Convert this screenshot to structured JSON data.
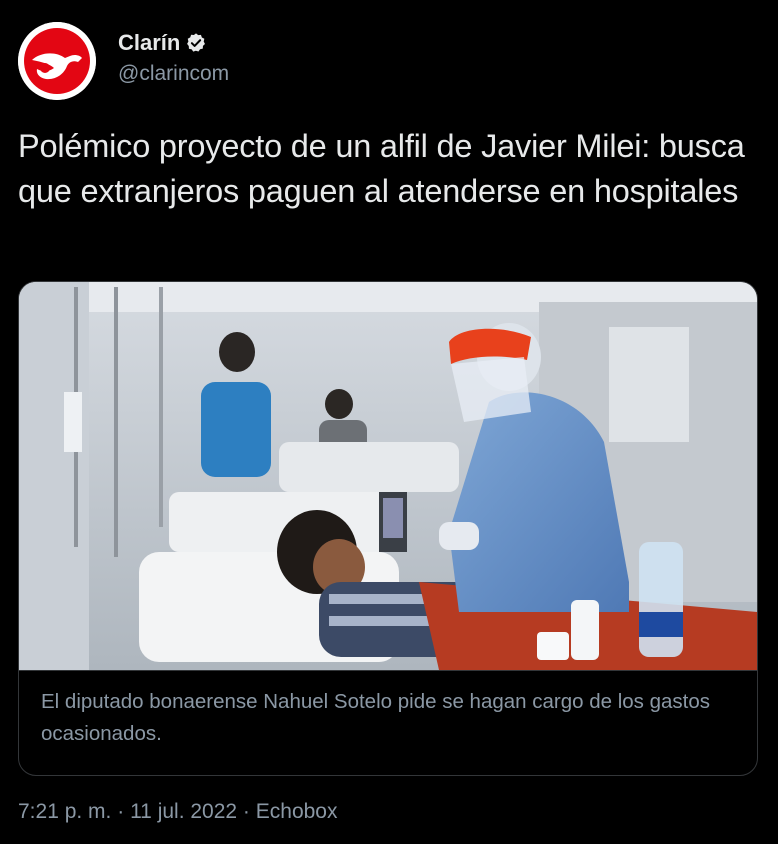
{
  "account": {
    "display_name": "Clarín",
    "handle": "@clarincom",
    "avatar_icon": "clarin-logo-icon",
    "verified_icon": "verified-badge-icon",
    "brand_color": "#e30613"
  },
  "tweet": {
    "text": "Polémico proyecto de un alfil de Javier Milei: busca que extranjeros paguen al atenderse en hospitales"
  },
  "card": {
    "image_alt": "Hospital ward with a healthcare worker in protective equipment attending a patient",
    "caption": "El diputado bonaerense Nahuel Sotelo pide se hagan cargo de los gastos ocasionados."
  },
  "meta": {
    "time": "7:21 p. m.",
    "sep1": " · ",
    "date": "11 jul. 2022",
    "sep2": " · ",
    "source": "Echobox"
  }
}
